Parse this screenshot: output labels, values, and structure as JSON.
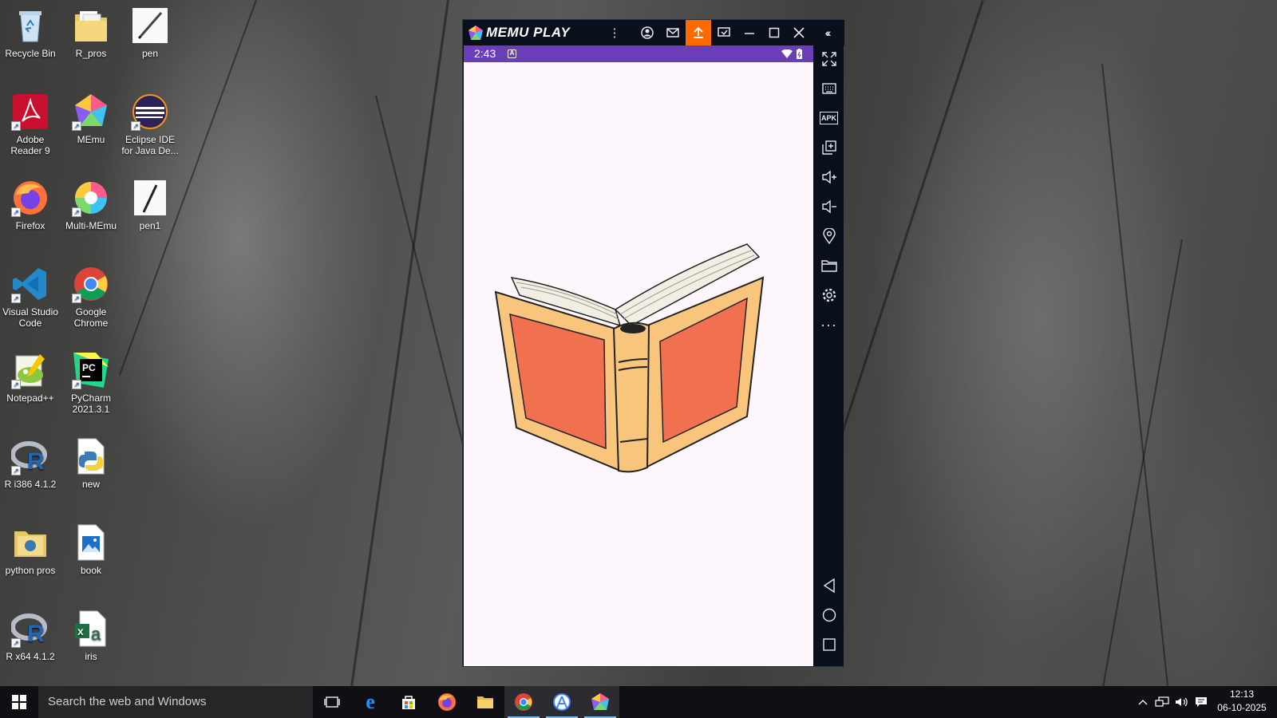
{
  "desktop": {
    "icons": [
      {
        "label": "Recycle Bin",
        "icon": "recycle-bin-icon"
      },
      {
        "label": "R_pros",
        "icon": "folder-icon"
      },
      {
        "label": "pen",
        "icon": "image-file-icon"
      },
      {
        "label": "Adobe Reader 9",
        "icon": "adobe-reader-icon"
      },
      {
        "label": "MEmu",
        "icon": "memu-icon"
      },
      {
        "label": "Eclipse IDE for Java De...",
        "icon": "eclipse-icon"
      },
      {
        "label": "Firefox",
        "icon": "firefox-icon"
      },
      {
        "label": "Multi-MEmu",
        "icon": "multi-memu-icon"
      },
      {
        "label": "pen1",
        "icon": "image-file-icon"
      },
      {
        "label": "Visual Studio Code",
        "icon": "vscode-icon"
      },
      {
        "label": "Google Chrome",
        "icon": "chrome-icon"
      },
      {
        "label": "Notepad++",
        "icon": "notepadpp-icon"
      },
      {
        "label": "PyCharm 2021.3.1",
        "icon": "pycharm-icon"
      },
      {
        "label": "R i386 4.1.2",
        "icon": "r-icon"
      },
      {
        "label": "new",
        "icon": "python-file-icon"
      },
      {
        "label": "python pros",
        "icon": "folder-icon"
      },
      {
        "label": "book",
        "icon": "image-file-icon"
      },
      {
        "label": "R x64 4.1.2",
        "icon": "r-icon"
      },
      {
        "label": "iris",
        "icon": "excel-file-icon"
      }
    ]
  },
  "emulator": {
    "brand": "MEMU PLAY",
    "title_buttons": [
      "kebab-menu-icon",
      "account-icon",
      "mail-icon",
      "upload-icon",
      "screen-record-icon",
      "minimize-icon",
      "maximize-icon",
      "close-icon",
      "collapse-sidebar-icon"
    ],
    "status": {
      "time": "2:43",
      "notification_icon": "a-badge-icon"
    },
    "sidebar": [
      "fullscreen-icon",
      "keyboard-icon",
      "apk-icon",
      "multi-window-icon",
      "volume-up-icon",
      "volume-down-icon",
      "location-icon",
      "folder-icon",
      "settings-icon",
      "more-icon"
    ],
    "sidebar_apk_label": "APK",
    "nav": [
      "back-icon",
      "home-icon",
      "recents-icon"
    ],
    "app_content": "open-book-illustration"
  },
  "taskbar": {
    "search_placeholder": "Search the web and Windows",
    "pinned": [
      "task-view-icon",
      "edge-icon",
      "store-icon",
      "firefox-icon",
      "file-explorer-icon",
      "chrome-icon",
      "android-studio-icon",
      "memu-icon"
    ],
    "active": [
      "chrome-icon",
      "android-studio-icon",
      "memu-icon"
    ],
    "tray": [
      "show-hidden-icons-icon",
      "network-icon",
      "volume-icon",
      "action-center-icon"
    ],
    "time": "12:13",
    "date": "06-10-2025"
  },
  "colors": {
    "accent": "#ff6a00",
    "statusbar": "#6a3eb6",
    "emu_bg": "#0a0f1c",
    "book_cover": "#f1704f",
    "book_binding": "#f9c57c"
  }
}
